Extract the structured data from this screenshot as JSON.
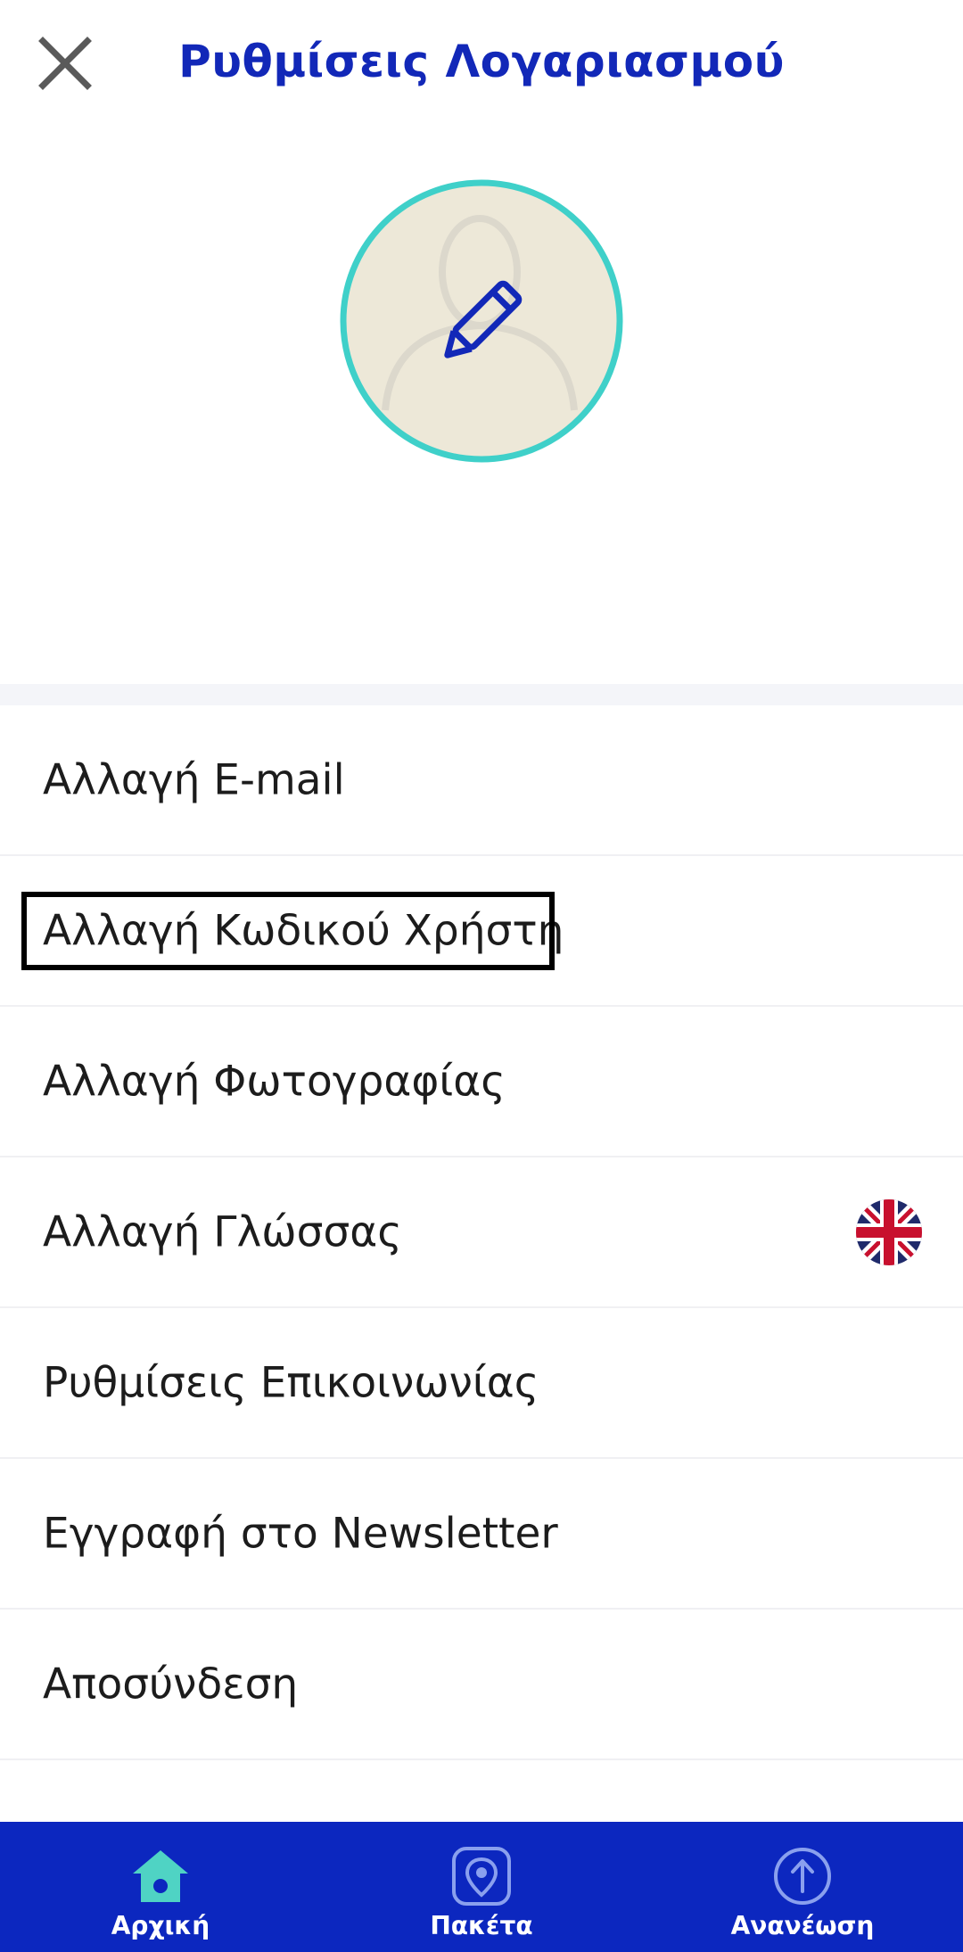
{
  "header": {
    "title": "Ρυθμίσεις Λογαριασμού",
    "close_icon": "close-icon"
  },
  "avatar": {
    "placeholder_icon": "person-silhouette-icon",
    "edit_icon": "pencil-icon",
    "ring_color": "#3fd0c9",
    "fill_color": "#ede8d8"
  },
  "menu": {
    "items": [
      {
        "label": "Αλλαγή E-mail"
      },
      {
        "label": "Αλλαγή Κωδικού Χρήστη"
      },
      {
        "label": "Αλλαγή Φωτογραφίας"
      },
      {
        "label": "Αλλαγή Γλώσσας",
        "trailing_icon": "uk-flag-icon"
      },
      {
        "label": "Ρυθμίσεις Επικοινωνίας"
      },
      {
        "label": "Εγγραφή στο Newsletter"
      },
      {
        "label": "Αποσύνδεση"
      }
    ]
  },
  "tabbar": {
    "background": "#0c27bf",
    "tabs": [
      {
        "label": "Αρχική",
        "icon": "home-icon",
        "active": true
      },
      {
        "label": "Πακέτα",
        "icon": "location-pin-icon",
        "active": false
      },
      {
        "label": "Ανανέωση",
        "icon": "upload-arrow-icon",
        "active": false
      }
    ]
  },
  "colors": {
    "accent": "#1228b8",
    "active_tab_icon": "#4fd3c4"
  }
}
